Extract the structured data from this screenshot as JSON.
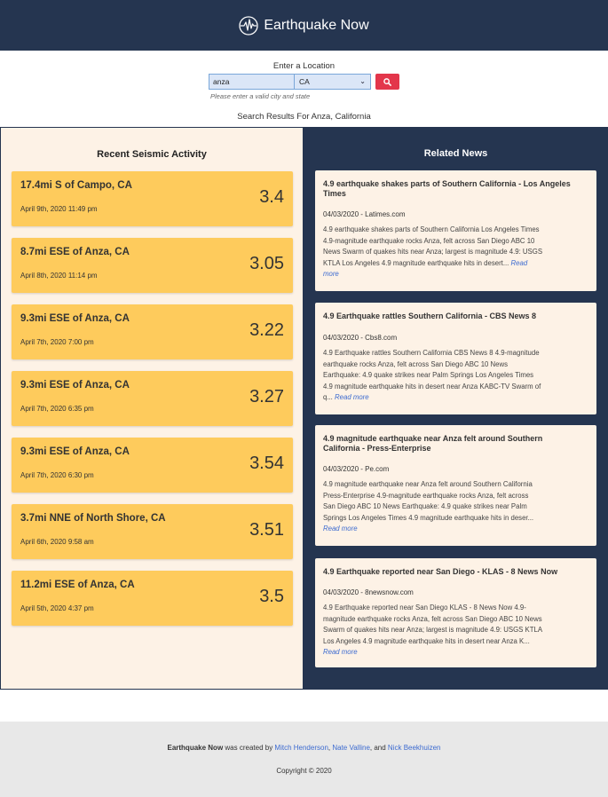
{
  "header": {
    "app_name": "Earthquake Now"
  },
  "search": {
    "label": "Enter a Location",
    "city_value": "anza",
    "state_value": "CA",
    "hint": "Please enter a valid city and state",
    "results_title": "Search Results For Anza, California"
  },
  "seismic": {
    "title": "Recent Seismic Activity",
    "items": [
      {
        "location": "17.4mi S of Campo, CA",
        "date": "April 9th, 2020 11:49 pm",
        "magnitude": "3.4"
      },
      {
        "location": "8.7mi ESE of Anza, CA",
        "date": "April 8th, 2020 11:14 pm",
        "magnitude": "3.05"
      },
      {
        "location": "9.3mi ESE of Anza, CA",
        "date": "April 7th, 2020 7:00 pm",
        "magnitude": "3.22"
      },
      {
        "location": "9.3mi ESE of Anza, CA",
        "date": "April 7th, 2020 6:35 pm",
        "magnitude": "3.27"
      },
      {
        "location": "9.3mi ESE of Anza, CA",
        "date": "April 7th, 2020 6:30 pm",
        "magnitude": "3.54"
      },
      {
        "location": "3.7mi NNE of North Shore, CA",
        "date": "April 6th, 2020 9:58 am",
        "magnitude": "3.51"
      },
      {
        "location": "11.2mi ESE of Anza, CA",
        "date": "April 5th, 2020 4:37 pm",
        "magnitude": "3.5"
      }
    ]
  },
  "news": {
    "title": "Related News",
    "read_more": "Read more",
    "items": [
      {
        "title": "4.9 earthquake shakes parts of Southern California - Los Angeles Times",
        "source": "04/03/2020 - Latimes.com",
        "body_lines": [
          "4.9 earthquake shakes parts of Southern California Los Angeles Times",
          "4.9-magnitude earthquake rocks Anza, felt across San Diego ABC 10",
          "News Swarm of quakes hits near Anza; largest is magnitude 4.9: USGS",
          "KTLA Los Angeles 4.9 magnitude earthquake hits in desert..."
        ],
        "more_prefix": "Read",
        "more_suffix": "more"
      },
      {
        "title": "4.9 Earthquake rattles Southern California - CBS News 8",
        "source": "04/03/2020 - Cbs8.com",
        "body_lines": [
          "4.9 Earthquake rattles Southern California CBS News 8 4.9-magnitude",
          "earthquake rocks Anza, felt across San Diego ABC 10 News",
          "Earthquake: 4.9 quake strikes near Palm Springs Los Angeles Times",
          "4.9 magnitude earthquake hits in desert near Anza KABC-TV Swarm of",
          "q..."
        ]
      },
      {
        "title": "4.9 magnitude earthquake near Anza felt around Southern California - Press-Enterprise",
        "source": "04/03/2020 - Pe.com",
        "body_lines": [
          "4.9 magnitude earthquake near Anza felt around Southern California",
          "Press-Enterprise 4.9-magnitude earthquake rocks Anza, felt across",
          "San Diego ABC 10 News Earthquake: 4.9 quake strikes near Palm",
          "Springs Los Angeles Times 4.9 magnitude earthquake hits in deser..."
        ]
      },
      {
        "title": "4.9 Earthquake reported near San Diego - KLAS - 8 News Now",
        "source": "04/03/2020 - 8newsnow.com",
        "body_lines": [
          "4.9 Earthquake reported near San Diego KLAS - 8 News Now 4.9-",
          "magnitude earthquake rocks Anza, felt across San Diego ABC 10 News",
          "Swarm of quakes hits near Anza; largest is magnitude 4.9: USGS KTLA",
          "Los Angeles 4.9 magnitude earthquake hits in desert near Anza K..."
        ]
      }
    ]
  },
  "footer": {
    "brand": "Earthquake Now",
    "created_by": " was created by ",
    "author1": "Mitch Henderson",
    "sep1": ", ",
    "author2": "Nate Valline",
    "sep2": ", and ",
    "author3": "Nick Beekhuizen",
    "copyright": "Copyright © 2020"
  },
  "colors": {
    "navy": "#253550",
    "quake_card": "#fecb5c",
    "panel_cream": "#fdf2e6",
    "search_button": "#e3364b",
    "link": "#3d6bd0"
  },
  "icons": [
    "seismograph-logo-icon",
    "search-icon",
    "chevron-down-icon"
  ]
}
